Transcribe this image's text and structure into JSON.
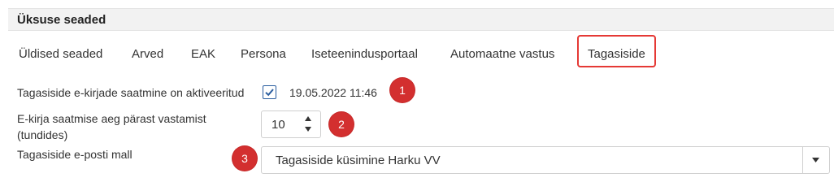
{
  "section": {
    "title": "Üksuse seaded"
  },
  "tabs": [
    {
      "label": "Üldised seaded"
    },
    {
      "label": "Arved"
    },
    {
      "label": "EAK"
    },
    {
      "label": "Persona"
    },
    {
      "label": "Iseteenindusportaal"
    },
    {
      "label": "Automaatne vastus"
    },
    {
      "label": "Tagasiside",
      "active": true
    }
  ],
  "form": {
    "feedback_enabled": {
      "label": "Tagasiside e-kirjade saatmine on aktiveeritud",
      "checked": true,
      "timestamp": "19.05.2022 11:46"
    },
    "send_delay": {
      "label_line1": "E-kirja saatmise aeg pärast vastamist",
      "label_line2": "(tundides)",
      "value": "10"
    },
    "email_template": {
      "label": "Tagasiside e-posti mall",
      "selected": "Tagasiside küsimine Harku VV"
    }
  },
  "badges": [
    "1",
    "2",
    "3"
  ],
  "colors": {
    "badge": "#d32f2f",
    "active_tab_border": "#e53935",
    "checkbox": "#2a5d9f"
  }
}
